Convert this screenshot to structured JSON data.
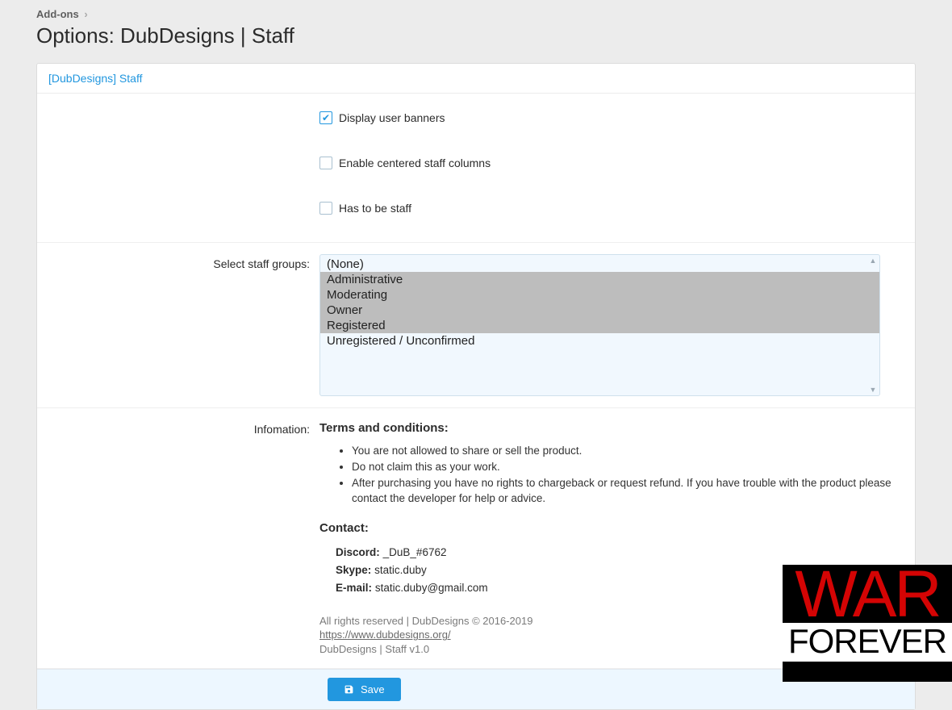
{
  "breadcrumb": {
    "item": "Add-ons"
  },
  "title": "Options: DubDesigns | Staff",
  "tab": "[DubDesigns] Staff",
  "checks": {
    "display_banners": {
      "label": "Display user banners",
      "checked": true
    },
    "centered_cols": {
      "label": "Enable centered staff columns",
      "checked": false
    },
    "has_to_be_staff": {
      "label": "Has to be staff",
      "checked": false
    }
  },
  "groups": {
    "label": "Select staff groups:",
    "options": [
      {
        "text": "(None)",
        "selected": false
      },
      {
        "text": "Administrative",
        "selected": true
      },
      {
        "text": "Moderating",
        "selected": true
      },
      {
        "text": "Owner",
        "selected": true
      },
      {
        "text": "Registered",
        "selected": true
      },
      {
        "text": "Unregistered / Unconfirmed",
        "selected": false
      }
    ]
  },
  "info": {
    "label": "Infomation:",
    "terms_heading": "Terms and conditions:",
    "terms": [
      "You are not allowed to share or sell the product.",
      "Do not claim this as your work.",
      "After purchasing you have no rights to chargeback or request refund. If you have trouble with the product please contact the developer for help or advice."
    ],
    "contact_heading": "Contact:",
    "contact": {
      "discord_label": "Discord:",
      "discord_value": "_DuB_#6762",
      "skype_label": "Skype:",
      "skype_value": "static.duby",
      "email_label": "E-mail:",
      "email_value": "static.duby@gmail.com"
    },
    "foot1": "All rights reserved | DubDesigns © 2016-2019",
    "foot_link": "https://www.dubdesigns.org/",
    "foot2": "DubDesigns | Staff v1.0"
  },
  "save_label": "Save",
  "wm": {
    "line1": "WAR",
    "line2": "FOREVER"
  }
}
